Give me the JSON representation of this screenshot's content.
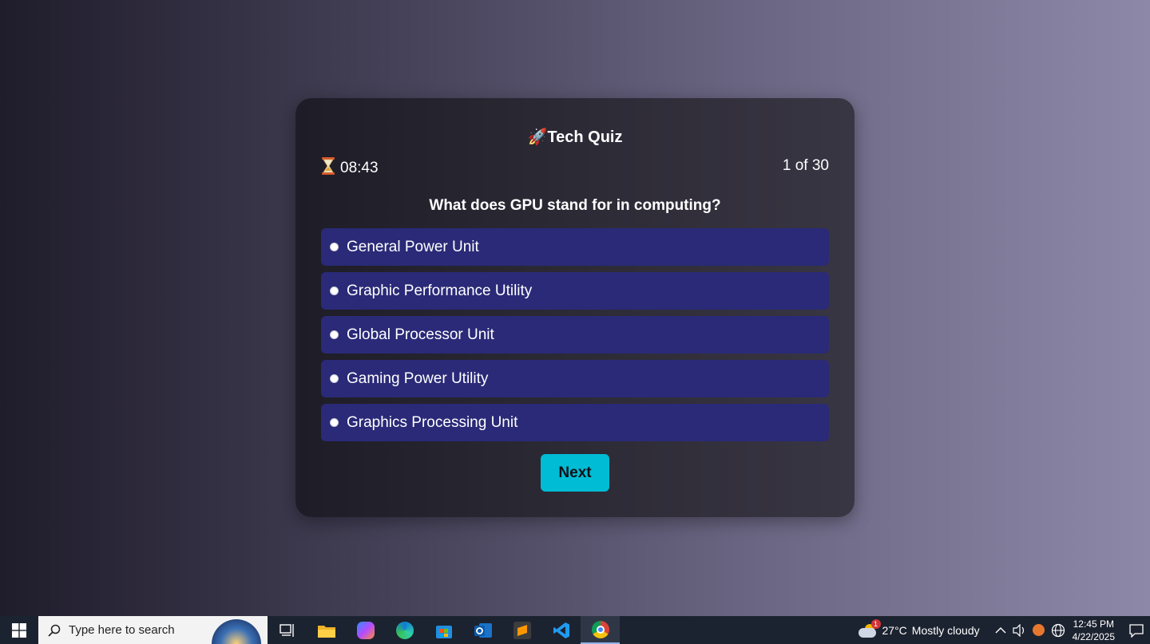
{
  "quiz": {
    "title": "Tech Quiz",
    "title_icon": "rocket-icon",
    "timer": "08:43",
    "timer_icon": "hourglass-icon",
    "progress": "1 of 30",
    "question": "What does GPU stand for in computing?",
    "options": [
      "General Power Unit",
      "Graphic Performance Utility",
      "Global Processor Unit",
      "Gaming Power Utility",
      "Graphics Processing Unit"
    ],
    "next_label": "Next"
  },
  "taskbar": {
    "search_placeholder": "Type here to search",
    "apps": [
      "task-view-icon",
      "file-explorer-icon",
      "copilot-icon",
      "edge-icon",
      "store-icon",
      "outlook-icon",
      "sublime-text-icon",
      "vscode-icon",
      "chrome-icon"
    ],
    "weather_temp": "27°C",
    "weather_text": "Mostly cloudy",
    "weather_badge": "1",
    "time": "12:45 PM",
    "date": "4/22/2025"
  },
  "colors": {
    "accent": "#00bcd4",
    "option_bg": "#2a2a78",
    "card_bg": "#2c2a35"
  }
}
